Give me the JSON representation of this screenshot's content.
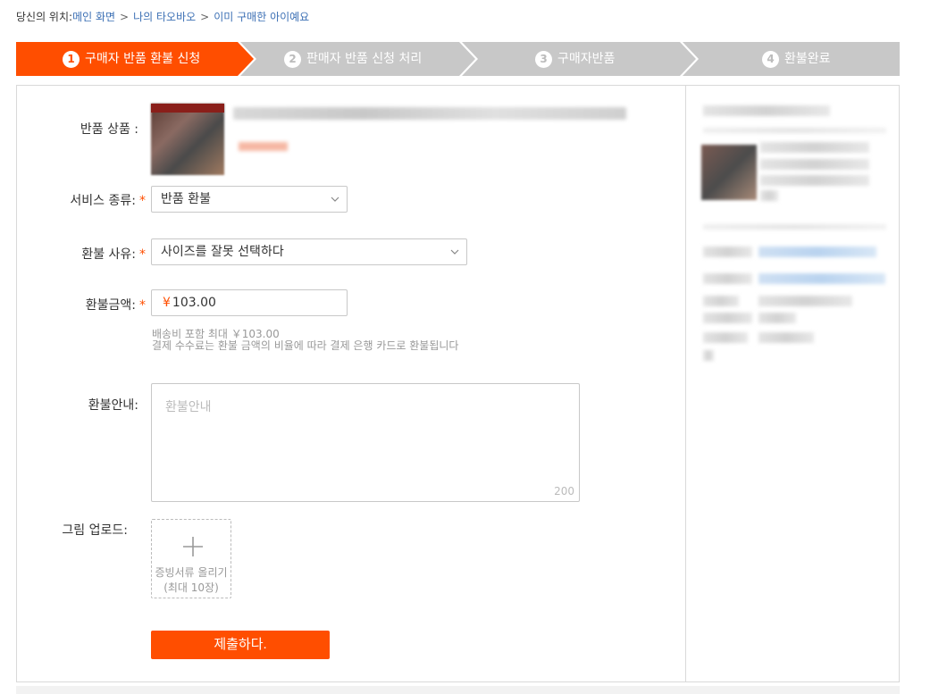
{
  "breadcrumb": {
    "prefix": "당신의 위치:",
    "items": [
      "메인 화면",
      "나의 타오바오",
      "이미 구매한 아이예요"
    ],
    "separator": ">"
  },
  "steps": [
    {
      "num": "1",
      "label": "구매자 반품 환불 신청",
      "active": true
    },
    {
      "num": "2",
      "label": "판매자 반품 신청 처리",
      "active": false
    },
    {
      "num": "3",
      "label": "구매자반품",
      "active": false
    },
    {
      "num": "4",
      "label": "환불완료",
      "active": false
    }
  ],
  "colors": {
    "accent": "#ff4e00",
    "inactive_step": "#c8c8c8",
    "link": "#3b6fb4"
  },
  "form": {
    "product_label": "반품 상품 :",
    "service_label": "서비스 종류:",
    "service_value": "반품 환불",
    "reason_label": "환불 사유:",
    "reason_value": "사이즈를 잘못 선택하다",
    "amount_label": "환불금액:",
    "currency": "¥",
    "amount_value": "103.00",
    "hint_line1": "배송비 포함 최대 ￥103.00",
    "hint_line2": "결제 수수료는 환불 금액의 비율에 따라 결제 은행 카드로 환불됩니다",
    "notes_label": "환불안내:",
    "notes_placeholder": "환불안내",
    "notes_counter": "200",
    "upload_label": "그림 업로드:",
    "upload_line1": "증빙서류 올리기",
    "upload_line2": "(최대 10장)",
    "submit_label": "제출하다.",
    "required_mark": "*"
  },
  "icons": {
    "select_arrow": "chevron-down-icon",
    "upload": "plus-icon"
  }
}
